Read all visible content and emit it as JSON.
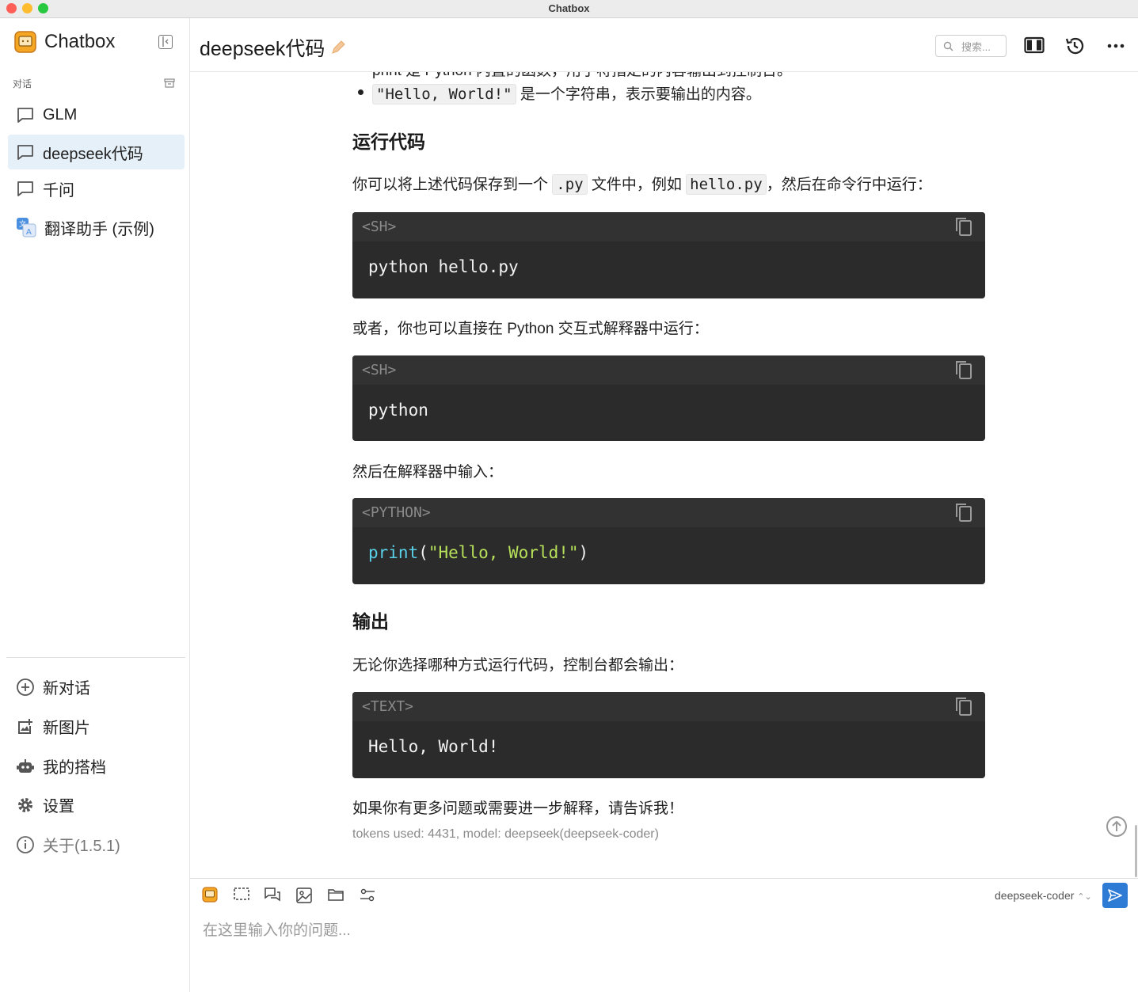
{
  "window": {
    "title": "Chatbox"
  },
  "sidebar": {
    "brand": "Chatbox",
    "section_label": "对话",
    "conversations": [
      {
        "label": "GLM",
        "active": false
      },
      {
        "label": "deepseek代码",
        "active": true
      },
      {
        "label": "千问",
        "active": false
      },
      {
        "label": "翻译助手 (示例)",
        "active": false
      }
    ],
    "nav": [
      {
        "label": "新对话",
        "icon": "add-circle-icon"
      },
      {
        "label": "新图片",
        "icon": "add-image-icon"
      },
      {
        "label": "我的搭档",
        "icon": "robot-icon"
      },
      {
        "label": "设置",
        "icon": "gear-icon"
      },
      {
        "label": "关于(1.5.1)",
        "icon": "info-icon"
      }
    ]
  },
  "header": {
    "title": "deepseek代码",
    "search_placeholder": "搜索..."
  },
  "message": {
    "bullet_partial": "print 是 Python 内置的函数，用于将指定的内容输出到控制台。",
    "bullet_code": "\"Hello, World!\"",
    "bullet_text": " 是一个字符串，表示要输出的内容。",
    "heading_run": "运行代码",
    "para1_a": "你可以将上述代码保存到一个 ",
    "para1_code1": ".py",
    "para1_b": " 文件中，例如 ",
    "para1_code2": "hello.py",
    "para1_c": "，然后在命令行中运行：",
    "code1_lang": "<SH>",
    "code1_body": "python hello.py",
    "para2": "或者，你也可以直接在 Python 交互式解释器中运行：",
    "code2_lang": "<SH>",
    "code2_body": "python",
    "para3": "然后在解释器中输入：",
    "code3_lang": "<PYTHON>",
    "code3_fn": "print",
    "code3_open": "(",
    "code3_str": "\"Hello, World!\"",
    "code3_close": ")",
    "heading_output": "输出",
    "para4": "无论你选择哪种方式运行代码，控制台都会输出：",
    "code4_lang": "<TEXT>",
    "code4_body": "Hello, World!",
    "para5": "如果你有更多问题或需要进一步解释，请告诉我！",
    "meta": "tokens used: 4431, model: deepseek(deepseek-coder)"
  },
  "input": {
    "placeholder": "在这里输入你的问题...",
    "model": "deepseek-coder"
  },
  "colors": {
    "accent": "#2e7bd6",
    "active_bg": "#e6f0f8",
    "code_bg": "#2b2b2b"
  }
}
